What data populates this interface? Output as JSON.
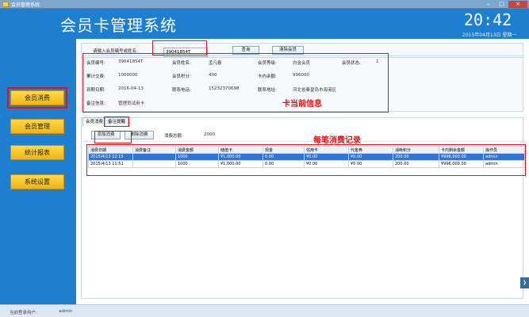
{
  "window": {
    "title": "会员管理系统",
    "minimize": "–",
    "restore": "□",
    "close": "×"
  },
  "header": {
    "title": "会员卡管理系统",
    "time": "20:42",
    "date": "2015年04月13日  星期一"
  },
  "sidebar": {
    "items": [
      {
        "label": "会员消费"
      },
      {
        "label": "会员管理"
      },
      {
        "label": "统计报表"
      },
      {
        "label": "系统设置"
      }
    ]
  },
  "search": {
    "label": "请输入会员编号或姓名:",
    "value": "39041854T",
    "query_btn": "查询",
    "clear_btn": "清除会员"
  },
  "member": {
    "id_label": "会员编号:",
    "id": "39041854T",
    "name_label": "会员姓名:",
    "name": "孟凡春",
    "level_label": "会员等级:",
    "level": "白金会员",
    "status_label": "会员状态:",
    "status": "1",
    "total_label": "累计交费:",
    "total": "1000000",
    "points_label": "会员积分:",
    "points": "400",
    "balance_label": "卡内余额:",
    "balance": "996000",
    "expire_label": "到期日期:",
    "expire": "2016-04-13",
    "phone_label": "联系电话:",
    "phone": "15232370698",
    "address_label": "联系地址:",
    "address": "河北省秦皇岛市海港区",
    "note_label": "备注信息:",
    "note": "管理员试用卡"
  },
  "annotations": {
    "card": "卡当前信息",
    "records": "每笔消费记录"
  },
  "tabs": [
    {
      "label": "会员消费"
    },
    {
      "label": "备注提醒"
    }
  ],
  "toolbar": {
    "add": "添加消费",
    "delete": "删除消费",
    "total_label": "消费总额:",
    "total": "2000"
  },
  "grid": {
    "columns": [
      "消费日期",
      "消费备注",
      "消费金额",
      "储值卡",
      "现金",
      "信用卡",
      "代金券",
      "消耗积分",
      "卡内剩余金额",
      "操作员"
    ],
    "rows": [
      [
        "2015/4/13 12:15",
        "",
        "1000",
        "¥1,000.00",
        "0.00",
        "¥0.00",
        "¥0.00",
        "200.00",
        "¥996,000.00",
        "admin"
      ],
      [
        "2015/4/13 11:51",
        "",
        "1000",
        "¥1,000.00",
        "0.00",
        "¥0.00",
        "¥0.00",
        "200.00",
        "¥996,000.00",
        "admin"
      ]
    ]
  },
  "status": {
    "user_label": "当前登录用户:",
    "user": "admin"
  },
  "colors": {
    "header_bg": "#1e7ed0",
    "nav_button": "#f5c22a",
    "highlight": "#e01515",
    "selected_row": "#2f74d6"
  }
}
